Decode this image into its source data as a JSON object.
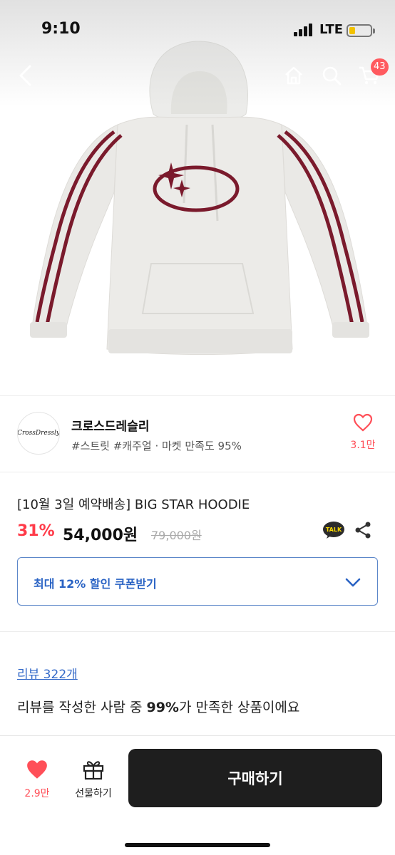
{
  "status_bar": {
    "time": "9:10",
    "network": "LTE",
    "battery_level": 0.3,
    "battery_color": "#f2c200"
  },
  "nav": {
    "back_icon": "chevron-left-icon",
    "home_icon": "home-icon",
    "search_icon": "search-icon",
    "cart_icon": "cart-icon",
    "cart_count": "43"
  },
  "product_image": {
    "subject": "hoodie"
  },
  "seller": {
    "logo_text": "CrossDressly",
    "name": "크로스드레슬리",
    "tags": "#스트릿 #캐주얼 · 마켓 만족도 95%",
    "like_count": "3.1만"
  },
  "product": {
    "title": "[10월 3일 예약배송] BIG STAR HOODIE",
    "discount": "31%",
    "price": "54,000원",
    "original_price": "79,000원",
    "talk_label": "TALK",
    "share_icon": "share-icon"
  },
  "coupon": {
    "label": "최대 12% 할인 쿠폰받기",
    "icon": "chevron-down-icon"
  },
  "review": {
    "link": "리뷰 322개",
    "summary_prefix": "리뷰를 작성한 사람 중 ",
    "summary_highlight": "99%",
    "summary_suffix": "가 만족한 상품이에요"
  },
  "bottom_bar": {
    "like_count": "2.9만",
    "gift_label": "선물하기",
    "buy_label": "구매하기"
  },
  "colors": {
    "accent_red": "#ff3b49",
    "link_blue": "#3268c8",
    "coupon_blue": "#2a63c4",
    "buy_button": "#1e1e1e",
    "hoodie_stripe": "#7a1a2c"
  }
}
